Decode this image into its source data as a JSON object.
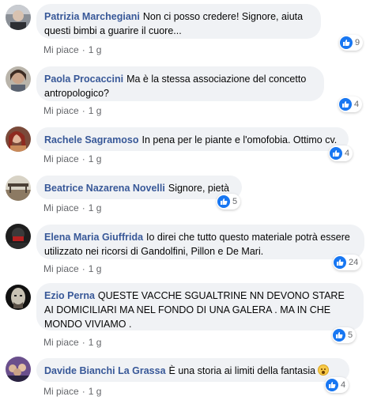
{
  "comments": [
    {
      "author": "Patrizia Marchegiani",
      "text": "Non ci posso credere! Signore, aiuta questi bimbi a guarire il cuore...",
      "reactions": "9",
      "like_label": "Mi piace",
      "separator": "·",
      "time": "1 g"
    },
    {
      "author": "Paola Procaccini",
      "text": "Ma è la stessa associazione del concetto antropologico?",
      "reactions": "4",
      "like_label": "Mi piace",
      "separator": "·",
      "time": "1 g"
    },
    {
      "author": "Rachele Sagramoso",
      "text": "In pena per le piante e l'omofobia. Ottimo cv.",
      "reactions": "4",
      "like_label": "Mi piace",
      "separator": "·",
      "time": "1 g"
    },
    {
      "author": "Beatrice Nazarena Novelli",
      "text": "Signore, pietà",
      "reactions": "5",
      "like_label": "Mi piace",
      "separator": "·",
      "time": "1 g"
    },
    {
      "author": "Elena Maria Giuffrida",
      "text": "Io direi che tutto questo materiale potrà essere utilizzato nei ricorsi di Gandolfini, Pillon e De Mari.",
      "reactions": "24",
      "like_label": "Mi piace",
      "separator": "·",
      "time": "1 g"
    },
    {
      "author": "Ezio Perna",
      "text": "QUESTE VACCHE SGUALTRINE NN DEVONO STARE AI DOMICILIARI MA NEL FONDO DI UNA GALERA . MA IN CHE MONDO VIVIAMO .",
      "reactions": "5",
      "like_label": "Mi piace",
      "separator": "·",
      "time": "1 g"
    },
    {
      "author": "Davide Bianchi La Grassa",
      "text": "È una storia ai limiti della fantasia",
      "reactions": "4",
      "like_label": "Mi piace",
      "separator": "·",
      "time": "1 g"
    }
  ],
  "colors": {
    "author": "#385898",
    "bubble": "#f0f2f5",
    "like_blue": "#1877f2",
    "meta": "#65676b"
  },
  "icons": {
    "reaction": "like-thumb-icon",
    "emoji": "grinning-face-icon"
  }
}
